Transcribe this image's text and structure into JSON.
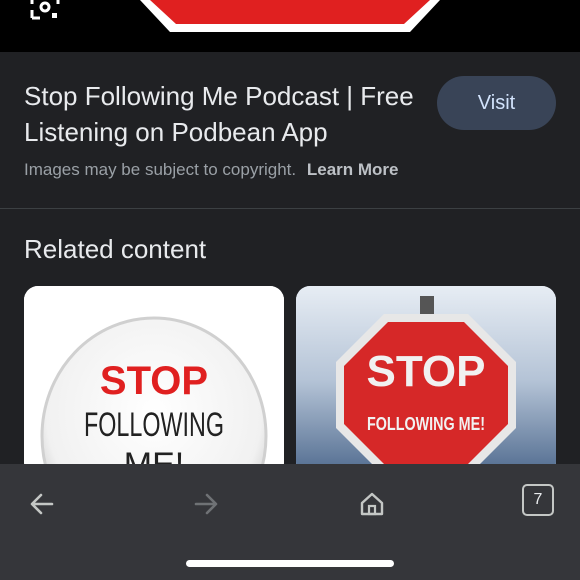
{
  "result": {
    "title": "Stop Following Me Podcast | Free Listening on Podbean App",
    "visit_label": "Visit",
    "copyright_text": "Images may be subject to copyright.",
    "learn_more_label": "Learn More"
  },
  "related": {
    "heading": "Related content",
    "cards": [
      {
        "line1": "STOP",
        "line2": "FOLLOWING",
        "line3": "ME!"
      },
      {
        "line1": "STOP",
        "line2": "FOLLOWING ME!"
      }
    ]
  },
  "bottom_nav": {
    "tab_count": "7",
    "icons": [
      "back-arrow-icon",
      "forward-arrow-icon",
      "home-icon",
      "tab-switcher-icon"
    ]
  },
  "colors": {
    "background": "#202124",
    "visit_button": "#394457",
    "stop_red": "#e02020",
    "bottom_bar": "#35363a"
  }
}
